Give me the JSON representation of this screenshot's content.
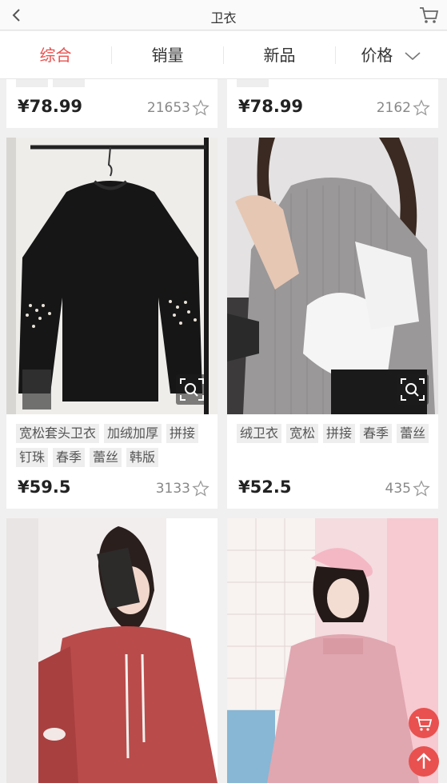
{
  "header": {
    "title": "卫衣",
    "back_icon": "chevron-left-icon",
    "cart_icon": "cart-icon"
  },
  "sort_tabs": [
    {
      "label": "综合",
      "active": true
    },
    {
      "label": "销量",
      "active": false
    },
    {
      "label": "新品",
      "active": false
    },
    {
      "label": "价格",
      "active": false
    }
  ],
  "products": [
    {
      "price": "¥78.99",
      "sales": "21653",
      "tags": [
        "",
        ""
      ]
    },
    {
      "price": "¥78.99",
      "sales": "2162",
      "tags": [
        ""
      ]
    },
    {
      "price": "¥59.5",
      "sales": "3133",
      "tags": [
        "宽松套头卫衣",
        "加绒加厚",
        "拼接",
        "钉珠",
        "春季",
        "蕾丝",
        "韩版"
      ]
    },
    {
      "price": "¥52.5",
      "sales": "435",
      "tags": [
        "绒卫衣",
        "宽松",
        "拼接",
        "春季",
        "蕾丝"
      ]
    }
  ],
  "colors": {
    "accent": "#e8514f",
    "tag_bg": "#eeeeee"
  }
}
